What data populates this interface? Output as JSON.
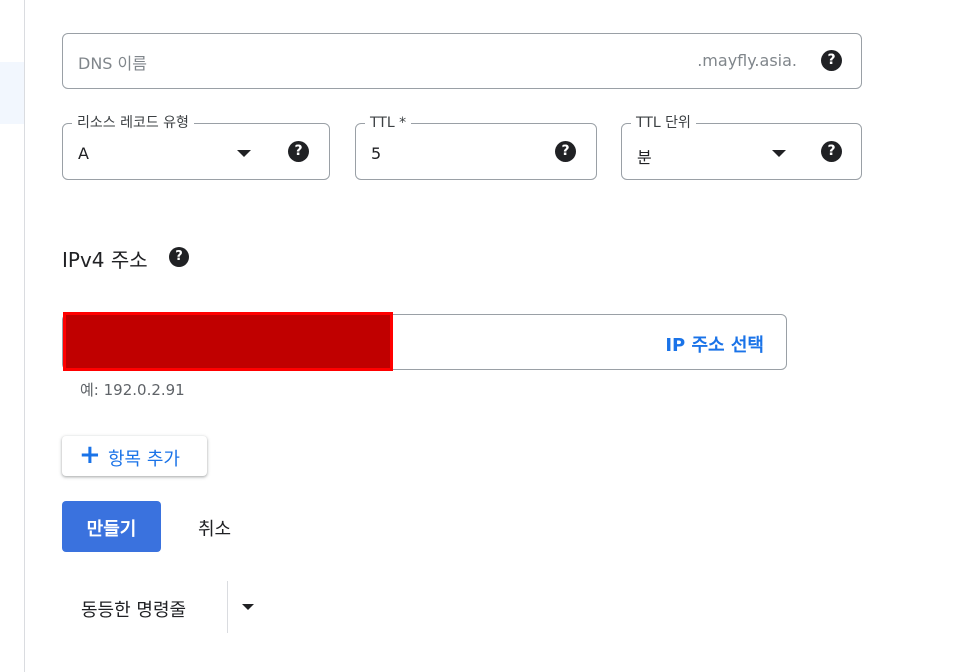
{
  "form": {
    "dns_name": {
      "placeholder": "DNS 이름",
      "suffix": ".mayfly.asia.",
      "help_icon": "question-circle-icon"
    },
    "record_type": {
      "label": "리소스 레코드 유형",
      "value": "A",
      "help_icon": "question-circle-icon"
    },
    "ttl": {
      "label": "TTL *",
      "value": "5",
      "help_icon": "question-circle-icon"
    },
    "ttl_unit": {
      "label": "TTL 단위",
      "value": "분",
      "help_icon": "question-circle-icon"
    },
    "ipv4": {
      "section_title": "IPv4 주소",
      "select_ip_label": "IP 주소 선택",
      "hint": "예: 192.0.2.91"
    },
    "add_item_label": "항목 추가"
  },
  "actions": {
    "create_label": "만들기",
    "cancel_label": "취소",
    "equivalent_cmdline_label": "동등한 명령줄"
  },
  "colors": {
    "accent": "#1a73e8",
    "primary_button": "#3a72de",
    "redaction": "#c00000",
    "border": "#9aa0a6"
  }
}
